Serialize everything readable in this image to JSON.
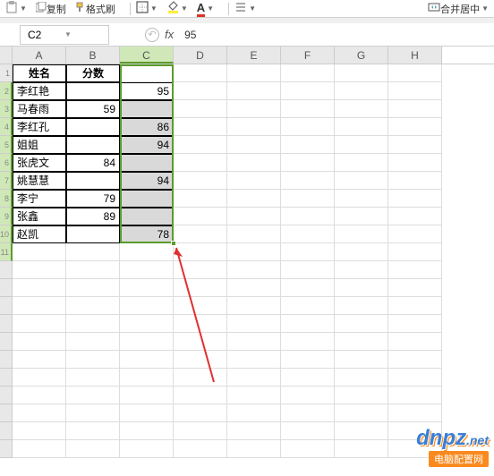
{
  "toolbar": {
    "copy_label": "复制",
    "format_painter_label": "格式刷",
    "merge_cells_label": "合并居中"
  },
  "namebox": {
    "ref": "C2"
  },
  "formula": {
    "fx_label": "fx",
    "value": "95"
  },
  "columns": [
    "A",
    "B",
    "C",
    "D",
    "E",
    "F",
    "G",
    "H"
  ],
  "rows_visible": 22,
  "selected_col_index": 2,
  "table": {
    "headers": [
      "姓名",
      "分数",
      ""
    ],
    "rows": [
      {
        "a": "李红艳",
        "b": "",
        "c": "95",
        "c_gray": false
      },
      {
        "a": "马春雨",
        "b": "59",
        "c": "",
        "c_gray": true
      },
      {
        "a": "李红孔",
        "b": "",
        "c": "86",
        "c_gray": true
      },
      {
        "a": "姐姐",
        "b": "",
        "c": "94",
        "c_gray": true
      },
      {
        "a": "张虎文",
        "b": "84",
        "c": "",
        "c_gray": true
      },
      {
        "a": "姚慧慧",
        "b": "",
        "c": "94",
        "c_gray": true
      },
      {
        "a": "李宁",
        "b": "79",
        "c": "",
        "c_gray": true
      },
      {
        "a": "张鑫",
        "b": "89",
        "c": "",
        "c_gray": true
      },
      {
        "a": "赵凯",
        "b": "",
        "c": "78",
        "c_gray": true
      }
    ]
  },
  "watermark": {
    "logo": "dnpz",
    "sub": "电脑配置网",
    "url": ".net"
  },
  "chart_data": {
    "type": "table",
    "categories": [
      "姓名",
      "分数",
      "C"
    ],
    "rows": [
      [
        "李红艳",
        null,
        95
      ],
      [
        "马春雨",
        59,
        null
      ],
      [
        "李红孔",
        null,
        86
      ],
      [
        "姐姐",
        null,
        94
      ],
      [
        "张虎文",
        84,
        null
      ],
      [
        "姚慧慧",
        null,
        94
      ],
      [
        "李宁",
        79,
        null
      ],
      [
        "张鑫",
        89,
        null
      ],
      [
        "赵凯",
        null,
        78
      ]
    ]
  }
}
